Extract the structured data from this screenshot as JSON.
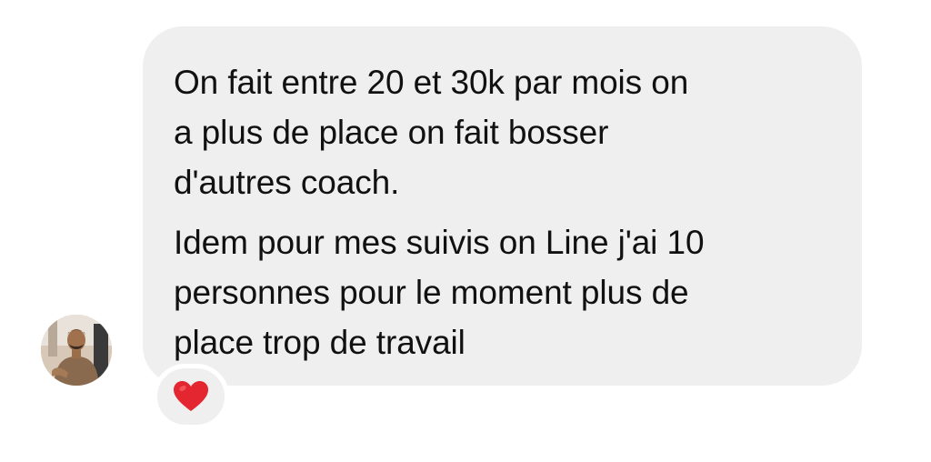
{
  "message": {
    "paragraphs": [
      [
        "On fait entre 20 et 30k par mois on",
        "a plus de place on fait bosser",
        "d'autres coach."
      ],
      [
        "Idem pour mes suivis on Line j'ai 10",
        "personnes pour le moment plus de",
        "place trop de travail"
      ]
    ]
  },
  "reaction": {
    "icon": "red-heart-icon",
    "color": "#e3262f"
  },
  "avatar": {
    "icon": "profile-avatar"
  },
  "colors": {
    "bubble": "#efefef",
    "text": "#111111",
    "background": "#ffffff"
  }
}
